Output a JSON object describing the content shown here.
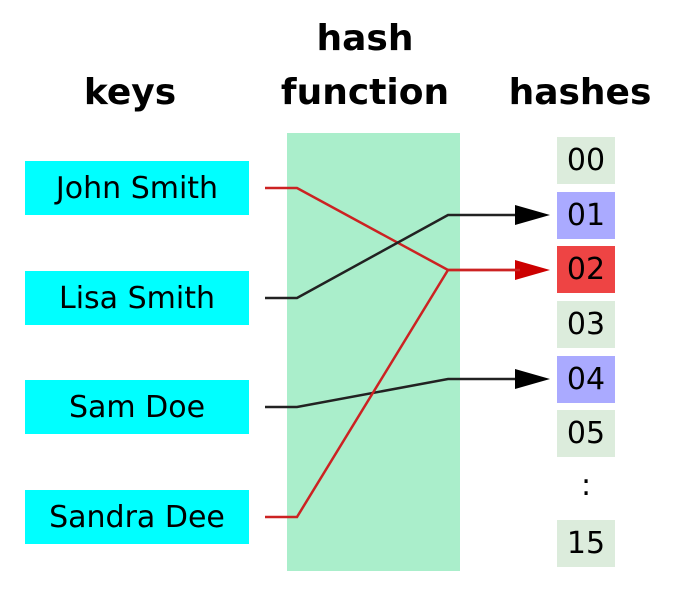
{
  "headers": {
    "keys": "keys",
    "hash_function_line1": "hash",
    "hash_function_line2": "function",
    "hashes": "hashes"
  },
  "keys": [
    {
      "label": "John Smith",
      "hash_index": 2,
      "color": "#cc2222"
    },
    {
      "label": "Lisa Smith",
      "hash_index": 1,
      "color": "#222222"
    },
    {
      "label": "Sam Doe",
      "hash_index": 4,
      "color": "#222222"
    },
    {
      "label": "Sandra Dee",
      "hash_index": 2,
      "color": "#cc2222"
    }
  ],
  "hashes": [
    {
      "label": "00",
      "state": "empty"
    },
    {
      "label": "01",
      "state": "used"
    },
    {
      "label": "02",
      "state": "collision"
    },
    {
      "label": "03",
      "state": "empty"
    },
    {
      "label": "04",
      "state": "used"
    },
    {
      "label": "05",
      "state": "empty"
    },
    {
      "label": ":",
      "state": "ellipsis"
    },
    {
      "label": "15",
      "state": "empty"
    }
  ],
  "colors": {
    "key_box": "#00ffff",
    "hash_function_box": "#aaeecb",
    "slot_empty": "#dcecdc",
    "slot_used": "#aaaaff",
    "slot_collision": "#ee4444",
    "line_normal": "#222222",
    "line_collision": "#cc2222"
  }
}
